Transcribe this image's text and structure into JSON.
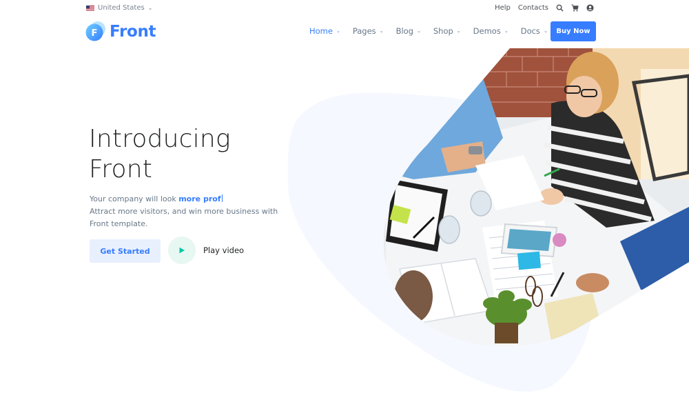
{
  "topbar": {
    "locale": "United States",
    "links": [
      "Help",
      "Contacts"
    ],
    "icons": [
      "search-icon",
      "cart-icon",
      "user-icon"
    ]
  },
  "brand": {
    "name": "Front",
    "mark": "F",
    "color": "#377dff"
  },
  "nav": {
    "items": [
      {
        "label": "Home",
        "active": true
      },
      {
        "label": "Pages",
        "active": false
      },
      {
        "label": "Blog",
        "active": false
      },
      {
        "label": "Shop",
        "active": false
      },
      {
        "label": "Demos",
        "active": false
      },
      {
        "label": "Docs",
        "active": false
      }
    ],
    "cta": "Buy Now"
  },
  "hero": {
    "title_line1": "Introducing",
    "title_line2": "Front",
    "sub_prefix": "Your company will look ",
    "sub_highlight": "more prof",
    "sub_line2": "Attract more visitors, and win more business with",
    "sub_line3": "Front template.",
    "primary_btn": "Get Started",
    "video_label": "Play video"
  },
  "colors": {
    "accent": "#377dff",
    "accent_soft": "#e8f0fe",
    "play_soft": "#e7f7f1",
    "play_icon": "#00c9a7",
    "blob": "#f5f8fe"
  }
}
